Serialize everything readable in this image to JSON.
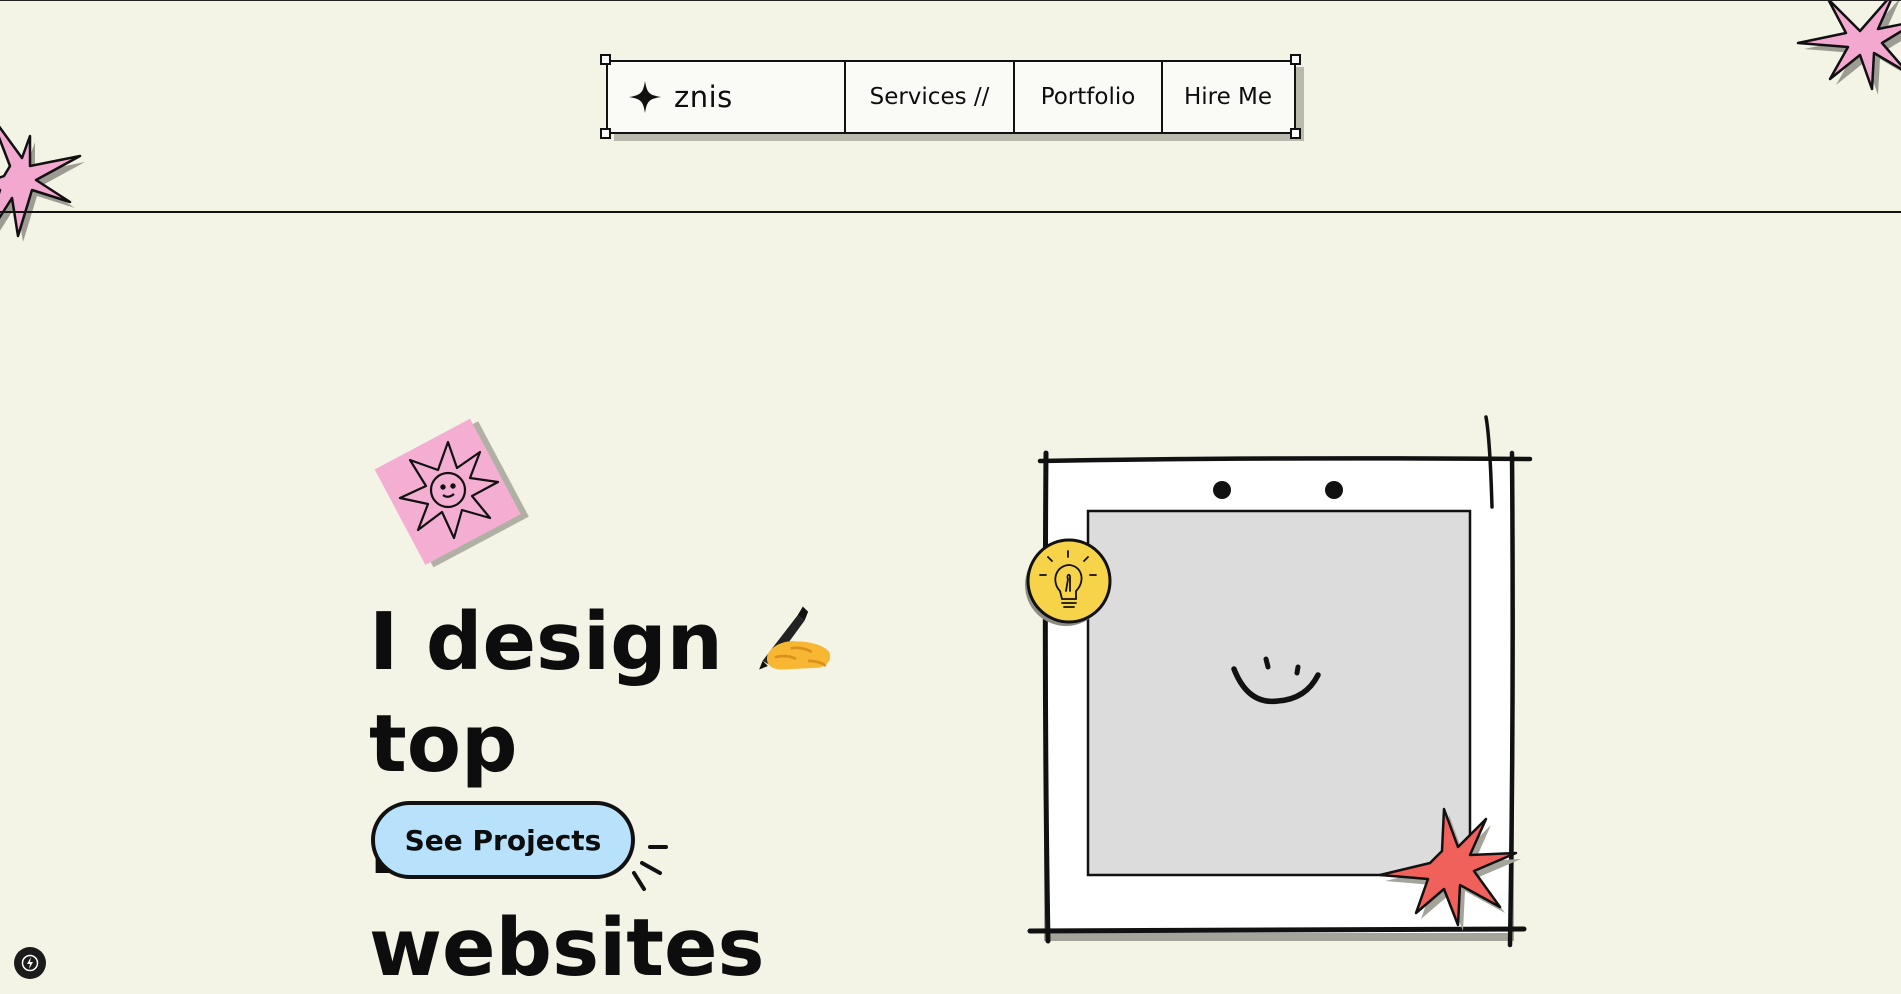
{
  "nav": {
    "logo_text": "znis",
    "items": [
      {
        "label": "Services //"
      },
      {
        "label": "Portfolio"
      },
      {
        "label": "Hire Me"
      }
    ]
  },
  "hero": {
    "title_part1": "I design",
    "title_emoji": "writing-hand-emoji",
    "title_part2": "top",
    "title_line2": "notch websites",
    "cta_label": "See Projects"
  },
  "icons": {
    "logo": "four-point-star-icon",
    "sticker_sun": "sun-sticker-icon",
    "lightbulb": "lightbulb-icon",
    "smiley": "smiley-face-icon",
    "corner_badge": "lightning-bolt-icon"
  },
  "colors": {
    "background": "#f3f3e6",
    "pink": "#f3a9cf",
    "coral": "#f0615c",
    "yellow": "#f7d34a",
    "cta_blue": "#b8e1fb",
    "ink": "#111111"
  }
}
